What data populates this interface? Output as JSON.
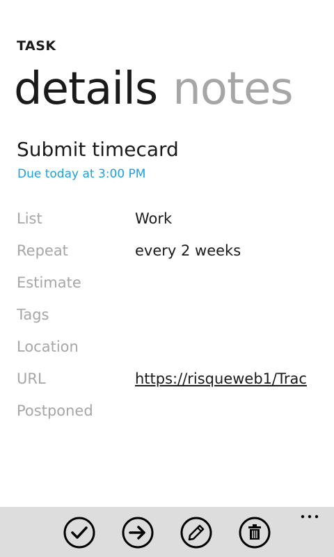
{
  "app": {
    "title": "TASK"
  },
  "pivot": {
    "items": [
      {
        "label": "details",
        "active": true
      },
      {
        "label": "notes",
        "active": false
      }
    ]
  },
  "task": {
    "title": "Submit timecard",
    "due": "Due today at 3:00 PM"
  },
  "properties": [
    {
      "label": "List",
      "value": "Work"
    },
    {
      "label": "Repeat",
      "value": "every 2 weeks"
    },
    {
      "label": "Estimate",
      "value": ""
    },
    {
      "label": "Tags",
      "value": ""
    },
    {
      "label": "Location",
      "value": ""
    },
    {
      "label": "URL",
      "value": "https://risqueweb1/Trac"
    },
    {
      "label": "Postponed",
      "value": ""
    }
  ],
  "appbar": {
    "buttons": [
      {
        "icon": "check-icon"
      },
      {
        "icon": "arrow-right-icon"
      },
      {
        "icon": "pencil-icon"
      },
      {
        "icon": "trash-icon"
      }
    ],
    "more_icon": "ellipsis-icon"
  },
  "colors": {
    "accent": "#1ba1e2",
    "secondary_text": "#a6a6a6",
    "appbar_background": "#dddddd"
  }
}
